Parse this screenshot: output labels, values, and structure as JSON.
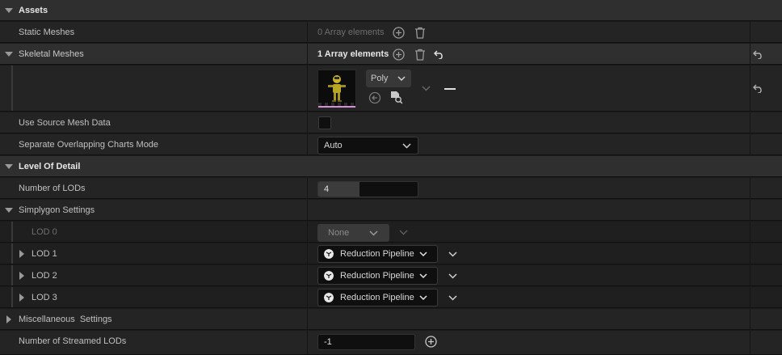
{
  "categories": {
    "assets": "Assets",
    "lod": "Level Of Detail"
  },
  "assets": {
    "static_meshes": {
      "label": "Static Meshes",
      "count": "0 Array elements"
    },
    "skeletal_meshes": {
      "label": "Skeletal Meshes",
      "count": "1 Array elements"
    },
    "mesh_entry": {
      "poly_label": "Poly"
    },
    "use_source_mesh": {
      "label": "Use Source Mesh Data",
      "checked": false
    },
    "overlap_mode": {
      "label": "Separate Overlapping Charts Mode",
      "value": "Auto"
    }
  },
  "lod": {
    "num_lods": {
      "label": "Number of LODs",
      "value": "4"
    },
    "simplygon": {
      "label": "Simplygon Settings"
    },
    "lod_rows": [
      {
        "label": "LOD 0",
        "value": "None",
        "disabled": true
      },
      {
        "label": "LOD 1",
        "value": "Reduction Pipeline"
      },
      {
        "label": "LOD 2",
        "value": "Reduction Pipeline"
      },
      {
        "label": "LOD 3",
        "value": "Reduction Pipeline"
      }
    ],
    "misc": {
      "label": "Miscellaneous  Settings"
    },
    "streamed": {
      "label": "Number of Streamed LODs",
      "value": "-1"
    }
  },
  "icons": {
    "expand": "triangle-down-icon",
    "collapse": "triangle-right-icon",
    "add": "plus-circle-icon",
    "delete": "trash-icon",
    "reset": "reset-arrow-icon",
    "browse": "browse-asset-icon",
    "use_selected": "use-selected-arrow-icon"
  },
  "colors": {
    "thumbnail_underline": "#d58fd8",
    "category_bg": "#2f2f2f",
    "row_bg": "#242424"
  }
}
